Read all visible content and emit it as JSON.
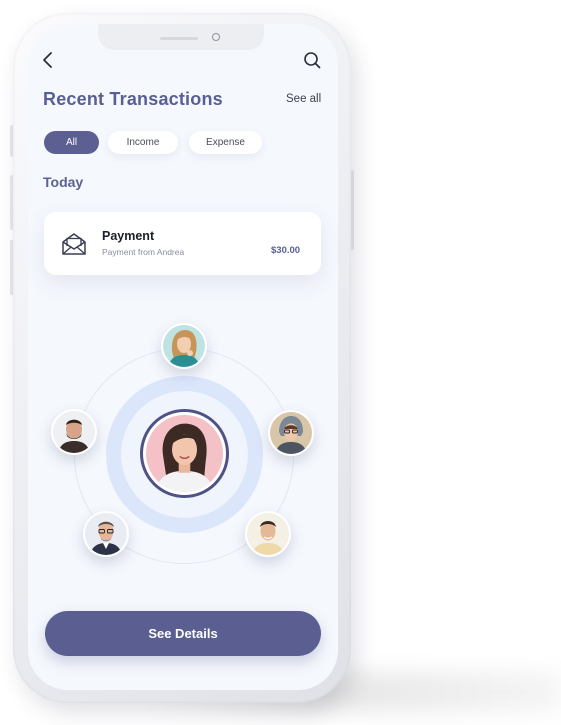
{
  "header": {
    "title": "Recent Transactions",
    "see_all_label": "See all"
  },
  "filters": {
    "selected": "All",
    "items": [
      {
        "label": "All"
      },
      {
        "label": "Income"
      },
      {
        "label": "Expense"
      }
    ]
  },
  "section": {
    "heading": "Today"
  },
  "transaction": {
    "title": "Payment",
    "subtitle": "Payment from Andrea",
    "amount": "$30.00"
  },
  "cta": {
    "label": "See Details"
  },
  "icons": {
    "back": "chevron-left-icon",
    "search": "search-icon",
    "transaction": "envelope-icon"
  },
  "colors": {
    "accent": "#5b5e91",
    "title": "#585e96",
    "screen_background": "#f5f8fd",
    "ring": "#dbe6fb"
  }
}
